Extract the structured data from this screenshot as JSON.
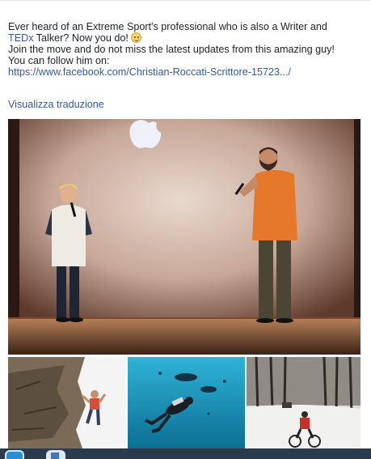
{
  "post": {
    "line1": "Ever heard of an Extreme Sport's professional who is also a Writer and",
    "line2_link": "TEDx",
    "line2_rest": " Talker? Now you do! ",
    "line3": "Join the move and do not miss the latest updates from this amazing guy!",
    "line4": "You can follow him on:",
    "url": "https://www.facebook.com/Christian-Roccati-Scrittore-15723.../",
    "emoji": "smiley-emoji"
  },
  "translate_label": "Visualizza traduzione",
  "photos": {
    "main": "stage-talk-photo",
    "thumbs": [
      "rock-climbing-photo",
      "scuba-diving-photo",
      "snow-biking-photo"
    ]
  },
  "colors": {
    "link": "#365899",
    "text": "#1d2129",
    "taskbar": "#2b3b4e"
  },
  "taskbar": {
    "icons": [
      "browser-icon",
      "app-icon"
    ]
  }
}
